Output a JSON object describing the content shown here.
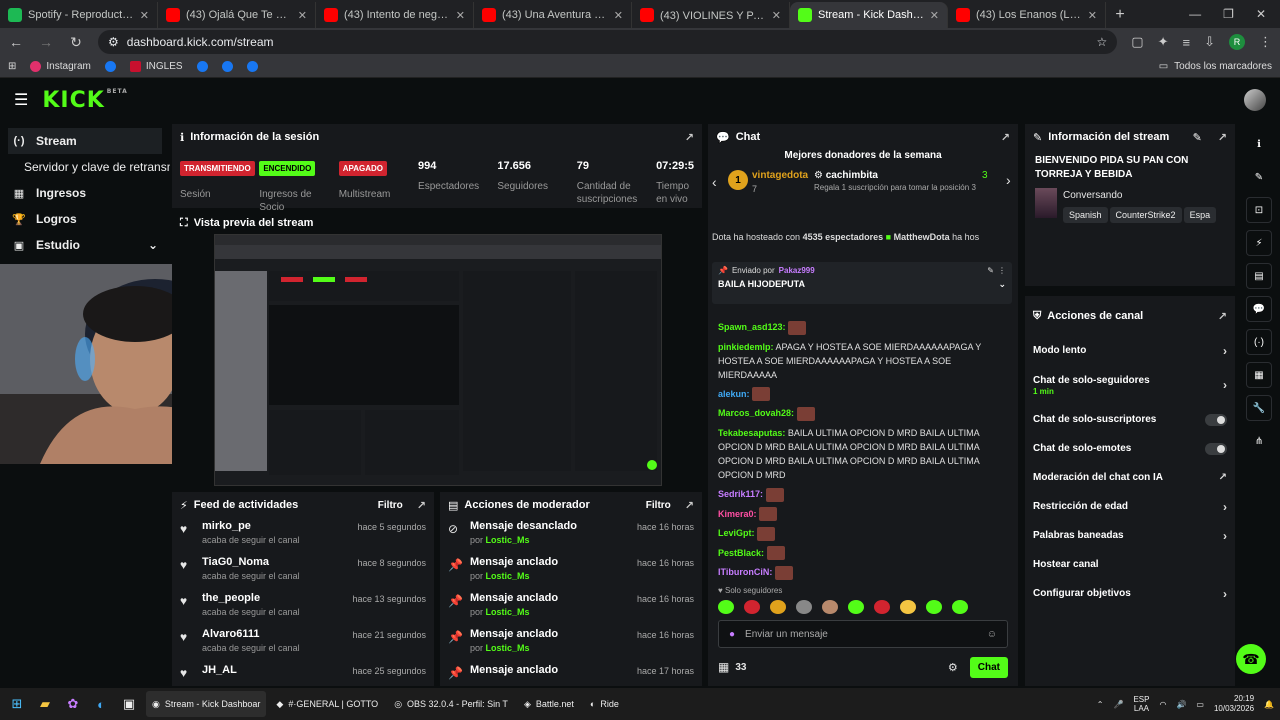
{
  "browser": {
    "tabs": [
      {
        "title": "Spotify - Reproductor web: mú",
        "color": "#1db954"
      },
      {
        "title": "(43) Ojalá Que Te Mueras - You",
        "color": "#ff0000"
      },
      {
        "title": "(43) Intento de negociación en",
        "color": "#ff0000"
      },
      {
        "title": "(43) Una Aventura Más - YouTu",
        "color": "#ff0000"
      },
      {
        "title": "(43) VIOLINES Y PARCHADAS 🔥",
        "color": "#ff0000"
      },
      {
        "title": "Stream - Kick Dashboard",
        "color": "#53fc18",
        "active": true
      },
      {
        "title": "(43) Los Enanos (Los Enanos S",
        "color": "#ff0000"
      }
    ],
    "url": "dashboard.kick.com/stream",
    "profile_initial": "R",
    "bookmarks": [
      "Instagram",
      "INGLES"
    ],
    "bookmarks_right": "Todos los marcadores"
  },
  "kick": {
    "logo": "KICK",
    "beta": "BETA"
  },
  "sidebar": {
    "items": [
      {
        "label": "Stream",
        "icon": "(·)"
      },
      {
        "label": "Servidor y clave de retransmisión",
        "icon": ""
      },
      {
        "label": "Ingresos",
        "icon": "▦"
      },
      {
        "label": "Logros",
        "icon": "🏆"
      },
      {
        "label": "Estudio",
        "icon": "▣"
      }
    ]
  },
  "session": {
    "title": "Información de la sesión",
    "stats": [
      {
        "badge": "TRANSMITIENDO",
        "label": "Sesión",
        "kind": "red"
      },
      {
        "badge": "ENCENDIDO",
        "label": "Ingresos de Socio",
        "kind": "green"
      },
      {
        "badge": "APAGADO",
        "label": "Multistream",
        "kind": "red"
      },
      {
        "value": "994",
        "label": "Espectadores"
      },
      {
        "value": "17.656",
        "label": "Seguidores"
      },
      {
        "value": "79",
        "label": "Cantidad de suscripciones"
      },
      {
        "value": "07:29:5",
        "label": "Tiempo en vivo"
      }
    ]
  },
  "preview": {
    "title": "Vista previa del stream"
  },
  "feed": {
    "title": "Feed de actividades",
    "filter": "Filtro",
    "items": [
      {
        "name": "mirko_pe",
        "sub": "acaba de seguir el canal",
        "time": "hace 5 segundos"
      },
      {
        "name": "TiaG0_Noma",
        "sub": "acaba de seguir el canal",
        "time": "hace 8 segundos"
      },
      {
        "name": "the_people",
        "sub": "acaba de seguir el canal",
        "time": "hace 13 segundos"
      },
      {
        "name": "Alvaro6111",
        "sub": "acaba de seguir el canal",
        "time": "hace 21 segundos"
      },
      {
        "name": "JH_AL",
        "sub": "",
        "time": "hace 25 segundos"
      }
    ]
  },
  "modactions": {
    "title": "Acciones de moderador",
    "filter": "Filtro",
    "by_prefix": "por",
    "items": [
      {
        "action": "Mensaje desanclado",
        "by": "Lostic_Ms",
        "time": "hace 16 horas"
      },
      {
        "action": "Mensaje anclado",
        "by": "Lostic_Ms",
        "time": "hace 16 horas"
      },
      {
        "action": "Mensaje anclado",
        "by": "Lostic_Ms",
        "time": "hace 16 horas"
      },
      {
        "action": "Mensaje anclado",
        "by": "Lostic_Ms",
        "time": "hace 16 horas"
      },
      {
        "action": "Mensaje anclado",
        "by": "",
        "time": "hace 17 horas"
      }
    ]
  },
  "chat": {
    "title": "Chat",
    "donors_title": "Mejores donadores de la semana",
    "donor1": {
      "rank": "1",
      "name": "vintagedota",
      "count": "7"
    },
    "donor2": {
      "name": "cachimbita",
      "desc": "Regala 1 suscripción para tomar la posición",
      "count": "3",
      "pos": "3"
    },
    "host_text": "Dota ha hosteado con",
    "host_count": "4535 espectadores",
    "host_by": "MatthewDota",
    "host_tail": "ha hos",
    "pinned_by_label": "Enviado por",
    "pinned_by": "Pakaz999",
    "pinned_text": "BAILA HIJODEPUTA",
    "messages": [
      {
        "user": "Spawn_asd123:",
        "color": "#53fc18",
        "text": ""
      },
      {
        "user": "pinkiedemlp:",
        "color": "#53fc18",
        "text": "APAGA Y HOSTEA A SOE MIERDAAAAAAPAGA Y HOSTEA A SOE MIERDAAAAAAPAGA Y HOSTEA A SOE MIERDAAAAA"
      },
      {
        "user": "alekun:",
        "color": "#3fa9f5",
        "text": ""
      },
      {
        "user": "Marcos_dovah28:",
        "color": "#53fc18",
        "text": ""
      },
      {
        "user": "Tekabesaputas:",
        "color": "#53fc18",
        "text": "BAILA ULTIMA OPCION D MRD BAILA ULTIMA OPCION D MRD BAILA ULTIMA OPCION D MRD BAILA ULTIMA OPCION D MRD BAILA ULTIMA OPCION D MRD BAILA ULTIMA OPCION D MRD"
      },
      {
        "user": "Sedrik117:",
        "color": "#c77dff",
        "text": ""
      },
      {
        "user": "Kimera0:",
        "color": "#ff4fa3",
        "text": ""
      },
      {
        "user": "LeviGpt:",
        "color": "#53fc18",
        "text": ""
      },
      {
        "user": "PestBlack:",
        "color": "#53fc18",
        "text": ""
      },
      {
        "user": "ITiburonCiN:",
        "color": "#c77dff",
        "text": ""
      }
    ],
    "followers_only": "Solo seguidores",
    "input_placeholder": "Enviar un mensaje",
    "count": "33",
    "send": "Chat"
  },
  "streaminfo": {
    "title": "Información del stream",
    "stream_title": "BIENVENIDO PIDA SU PAN CON TORREJA Y BEBIDA",
    "category": "Conversando",
    "tags": [
      "Spanish",
      "CounterStrike2",
      "Espa"
    ]
  },
  "channelactions": {
    "title": "Acciones de canal",
    "rows": [
      {
        "label": "Modo lento",
        "type": "chev"
      },
      {
        "label": "Chat de solo-seguidores",
        "sub": "1 min",
        "type": "chev"
      },
      {
        "label": "Chat de solo-suscriptores",
        "type": "toggle"
      },
      {
        "label": "Chat de solo-emotes",
        "type": "toggle"
      },
      {
        "label": "Moderación del chat con IA",
        "type": "ext"
      },
      {
        "label": "Restricción de edad",
        "type": "chev"
      },
      {
        "label": "Palabras baneadas",
        "type": "chev"
      },
      {
        "label": "Hostear canal",
        "type": "none"
      },
      {
        "label": "Configurar objetivos",
        "type": "chev"
      }
    ]
  },
  "taskbar": {
    "apps": [
      {
        "label": "Stream - Kick Dashboar",
        "active": true
      },
      {
        "label": "#·GENERAL | GOTTO"
      },
      {
        "label": "OBS 32.0.4 - Perfil: Sin T"
      },
      {
        "label": "Battle.net"
      },
      {
        "label": "Ride"
      }
    ],
    "lang": "ESP",
    "lang2": "LAA",
    "time": "20:19",
    "date": "10/03/2026"
  }
}
